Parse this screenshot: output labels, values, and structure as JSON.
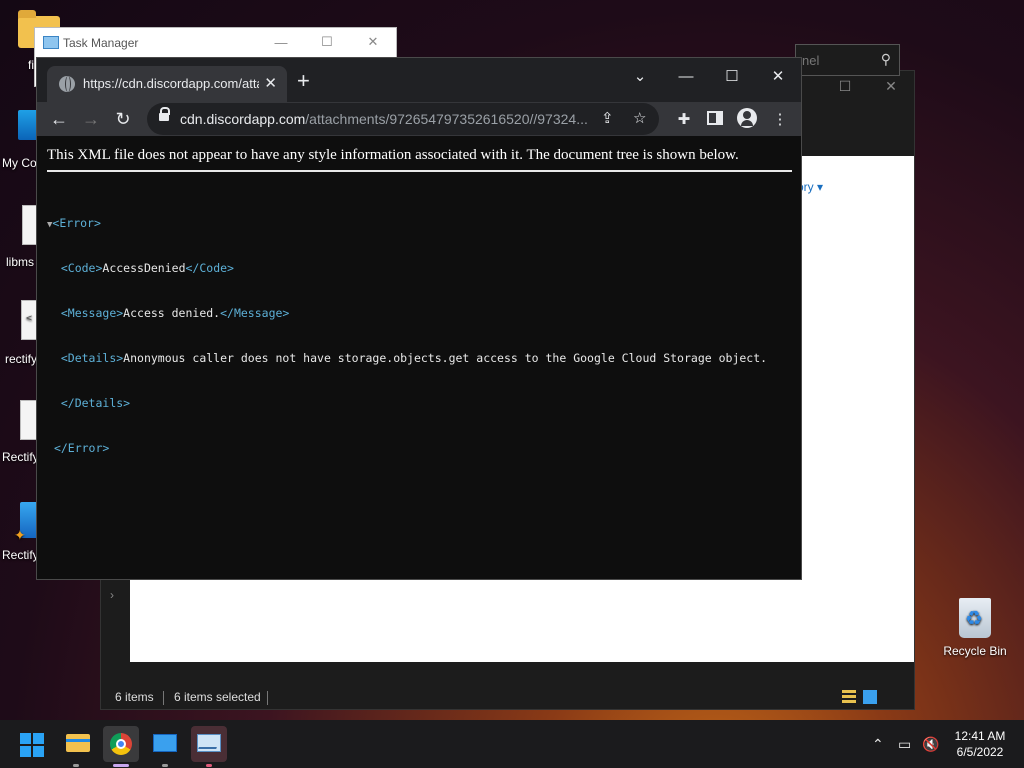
{
  "desktop": {
    "icons": [
      {
        "label": "fi"
      },
      {
        "label": "My Co"
      },
      {
        "label": "libms"
      },
      {
        "label": "rectify"
      },
      {
        "label": "Rectify"
      },
      {
        "label": "Rectify"
      }
    ],
    "file_icon_glyph": "<",
    "recycle_bin": "Recycle Bin"
  },
  "task_manager": {
    "title": "Task Manager"
  },
  "explorer": {
    "search_placeholder": "nel",
    "history_link": "ory",
    "status": {
      "items": "6 items",
      "selected": "6 items selected"
    }
  },
  "browser": {
    "tab_title": "https://cdn.discordapp.com/attac",
    "url_host": "cdn.discordapp.com",
    "url_path": "/attachments/972654797352616520//97324...",
    "xml_notice": "This XML file does not appear to have any style information associated with it. The document tree is shown below.",
    "xml": {
      "error_open": "<Error>",
      "code_open": "<Code>",
      "code_value": "AccessDenied",
      "code_close": "</Code>",
      "message_open": "<Message>",
      "message_value": "Access denied.",
      "message_close": "</Message>",
      "details_open": "<Details>",
      "details_value": "Anonymous caller does not have storage.objects.get access to the Google Cloud Storage object.",
      "details_close": "</Details>",
      "error_close": "</Error>"
    }
  },
  "taskbar": {
    "time": "12:41 AM",
    "date": "6/5/2022"
  },
  "colors": {
    "xml_tag": "#5db0d7",
    "chrome_frame": "#202124",
    "chrome_toolbar": "#35363a"
  }
}
